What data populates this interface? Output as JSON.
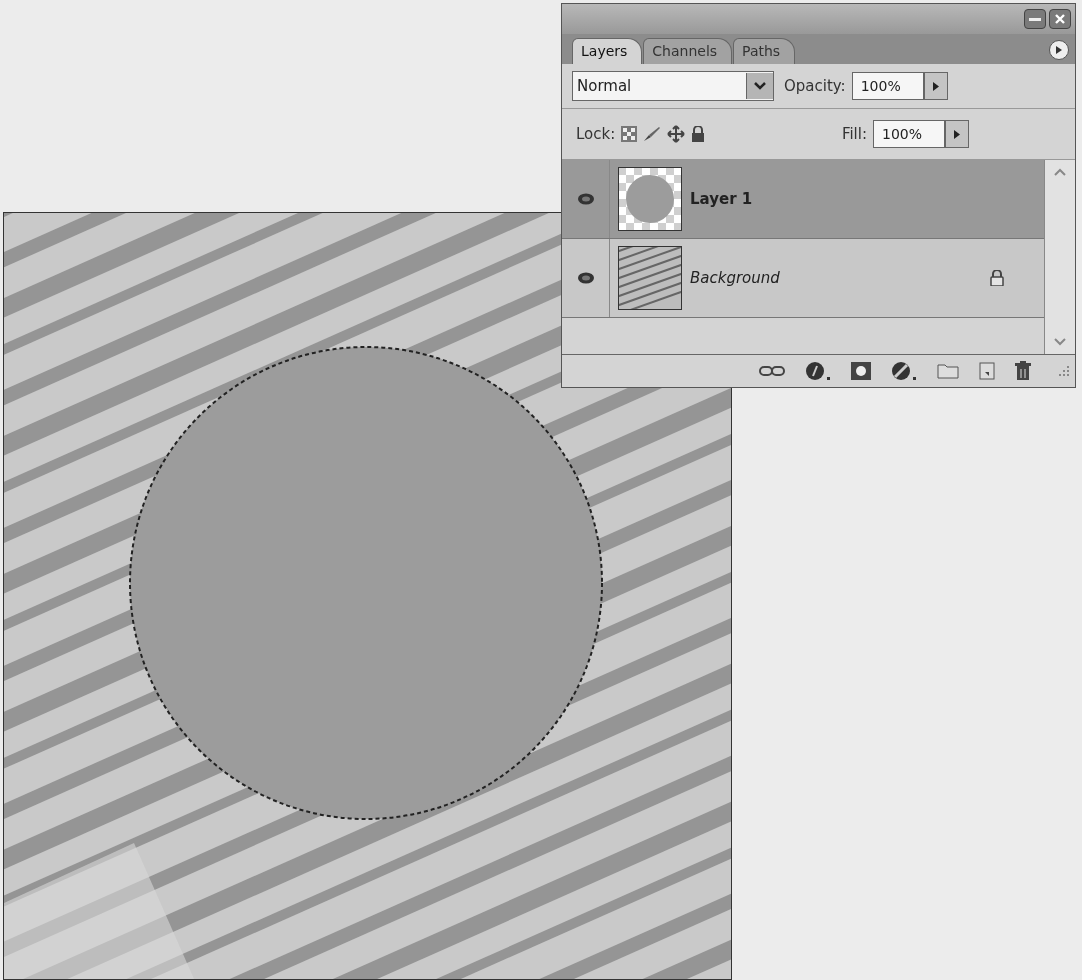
{
  "layers_panel": {
    "tabs": [
      {
        "label": "Layers",
        "selected": true
      },
      {
        "label": "Channels",
        "selected": false
      },
      {
        "label": "Paths",
        "selected": false
      }
    ],
    "blend_mode": "Normal",
    "opacity_label": "Opacity:",
    "opacity": "100%",
    "lock_label": "Lock:",
    "fill_label": "Fill:",
    "fill": "100%",
    "layers": [
      {
        "name": "Layer 1",
        "kind": "layer",
        "selected": true,
        "visible": true,
        "locked": false
      },
      {
        "name": "Background",
        "kind": "background",
        "selected": false,
        "visible": true,
        "locked": true
      }
    ]
  }
}
